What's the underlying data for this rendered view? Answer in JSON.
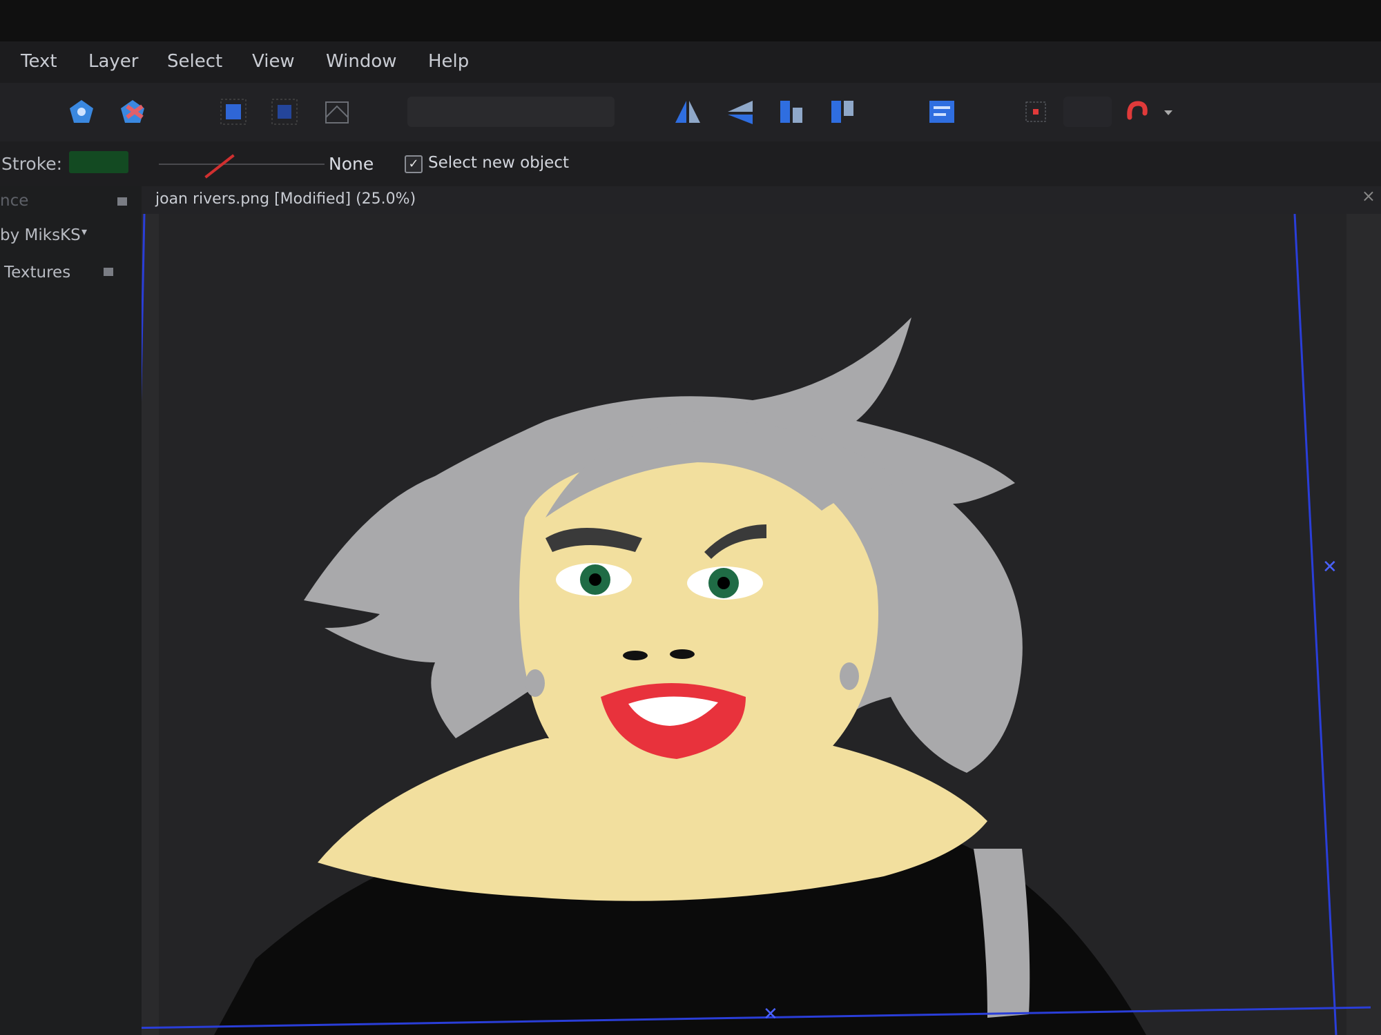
{
  "menu": {
    "items": [
      "Text",
      "Layer",
      "Select",
      "View",
      "Window",
      "Help"
    ]
  },
  "toolbar": {
    "icons": [
      "pentagon-shape-icon",
      "shape-builder-icon",
      "grid-select-icon",
      "grid-select-alt-icon",
      "transform-grid-icon",
      "flip-horizontal-icon",
      "flip-vertical-icon",
      "rotate-clockwise-icon",
      "rotate-counterclockwise-icon",
      "align-icon",
      "distribute-icon",
      "snapping-magnet-icon",
      "chevron-down-icon"
    ]
  },
  "context": {
    "stroke_label": "Stroke:",
    "stroke_value": "None",
    "select_new_object_label": "Select new object",
    "select_new_object_checked": true
  },
  "panels": {
    "appearance": "nce",
    "brushes_author": "by MiksKS",
    "textures": "Textures"
  },
  "document": {
    "title": "joan rivers.png [Modified] (25.0%)"
  },
  "colors": {
    "skin": "#f2df9e",
    "hair": "#a9a9ab",
    "lips": "#e8323c",
    "eyes": "#1f6b45",
    "dress": "#0b0b0b",
    "selection_bounds": "#2a3ed8"
  }
}
